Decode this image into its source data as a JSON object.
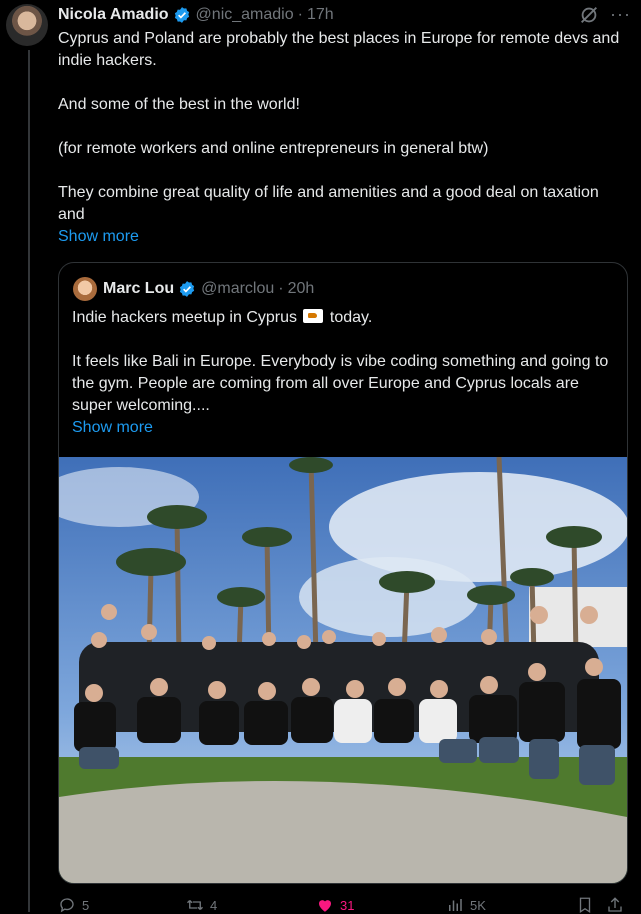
{
  "tweet": {
    "author_name": "Nicola Amadio",
    "handle": "@nic_amadio",
    "separator": "·",
    "time": "17h",
    "text": "Cyprus and Poland are probably the best places in Europe for remote devs and indie hackers.\n\nAnd some of the best in the world!\n\n(for remote workers and online entrepreneurs in general btw)\n\nThey combine great quality of life and amenities and a good deal on taxation and",
    "show_more": "Show more"
  },
  "quote": {
    "author_name": "Marc Lou",
    "handle": "@marclou",
    "separator": "·",
    "time": "20h",
    "text_line1_before": "Indie hackers meetup in Cyprus ",
    "text_line1_after": " today.",
    "text_rest": "It feels like Bali in Europe. Everybody is vibe coding something and going to the gym. People are coming from all over Europe and Cyprus locals are super welcoming....",
    "show_more": "Show more"
  },
  "actions": {
    "replies": "5",
    "reposts": "4",
    "likes": "31",
    "views": "5K"
  },
  "colors": {
    "background": "#000000",
    "text": "#e7e9ea",
    "muted": "#71767b",
    "link": "#1d9bf0",
    "like": "#f91880",
    "verified": "#1d9bf0"
  },
  "icons": [
    "verified-badge-icon",
    "grok-icon",
    "more-icon",
    "reply-icon",
    "repost-icon",
    "like-icon",
    "views-icon",
    "bookmark-icon",
    "share-icon"
  ]
}
